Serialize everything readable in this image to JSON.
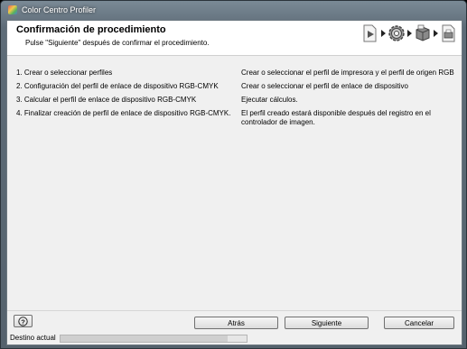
{
  "window": {
    "title": "Color Centro Profiler"
  },
  "header": {
    "title": "Confirmación de procedimiento",
    "subtitle": "Pulse \"Siguiente\" después de confirmar el procedimiento."
  },
  "steps": [
    {
      "left": "1. Crear o seleccionar perfiles",
      "right": "Crear o seleccionar el perfil de impresora y el perfil de origen RGB"
    },
    {
      "left": "2. Configuración del perfil de enlace de dispositivo RGB-CMYK",
      "right": "Crear o seleccionar el perfil de enlace de dispositivo"
    },
    {
      "left": "3. Calcular el perfil de enlace de dispositivo RGB-CMYK",
      "right": "Ejecutar cálculos."
    },
    {
      "left": "4. Finalizar creación de perfil de enlace de dispositivo RGB-CMYK.",
      "right": "El perfil creado estará disponible después del registro en el controlador de imagen."
    }
  ],
  "buttons": {
    "help": "?",
    "back": "Atrás",
    "next": "Siguiente",
    "cancel": "Cancelar"
  },
  "status": {
    "label": "Destino actual",
    "progress": 0.9
  },
  "icons": [
    "app-icon",
    "document-play-icon",
    "gear-icon",
    "printer-box-icon",
    "document-printer-icon",
    "help-icon"
  ]
}
